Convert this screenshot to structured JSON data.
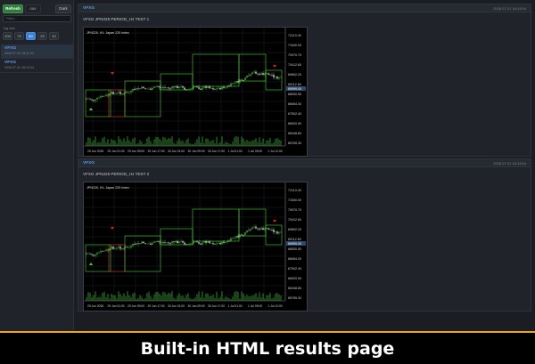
{
  "toolbar": {
    "refresh_label": "Refresh",
    "switch_label": "oav",
    "dark_label": "Dark"
  },
  "filter": {
    "placeholder": "Filter..."
  },
  "log_lines": {
    "label": "log size",
    "options": [
      "100",
      "75",
      "50",
      "25",
      "10"
    ],
    "active_index": 2
  },
  "sidebar_items": [
    {
      "title": "VFXG",
      "date": "2026.07.01 18:11:04"
    },
    {
      "title": "VFXG",
      "date": "2026.07.01 18:13:04"
    }
  ],
  "panels": [
    {
      "name": "VFXG",
      "date": "2026.07.01 18:13:04",
      "title": "VFXG JPN225 PERIOD_H1 TEST 1",
      "chart_label": "JPN225, H1:  Japan 225 Index",
      "price_labels": [
        "72113.40",
        "71540.00",
        "70970.70",
        "70412.60",
        "69692.20",
        "69112.60",
        "68530.50",
        "68084.00",
        "67502.40",
        "66920.90",
        "66348.80",
        "65765.30"
      ],
      "current_price": "69999.00",
      "time_labels": [
        "25 Jun 2026",
        "29 Jun 01:00",
        "29 Jun 09:00",
        "29 Jun 17:00",
        "30 Jun 01:00",
        "30 Jun 09:00",
        "30 Jun 17:00",
        "1 Jul 01:00",
        "1 Jul 09:00",
        "1 Jul 12:00"
      ]
    },
    {
      "name": "VFXG",
      "date": "2026.07.01 18:13:04",
      "title": "VFXG JPN225 PERIOD_H1 TEST 2",
      "chart_label": "JPN225, H1:  Japan 225 Index",
      "price_labels": [
        "72113.40",
        "71540.00",
        "70970.70",
        "70412.60",
        "69692.20",
        "69112.60",
        "68530.50",
        "68084.00",
        "67502.40",
        "66920.90",
        "66348.80",
        "65765.30"
      ],
      "current_price": "69999.00",
      "time_labels": [
        "25 Jun 2026",
        "29 Jun 01:00",
        "29 Jun 09:00",
        "29 Jun 17:00",
        "30 Jun 01:00",
        "30 Jun 09:00",
        "30 Jun 17:00",
        "1 Jul 01:00",
        "1 Jul 09:00",
        "1 Jul 12:00"
      ]
    }
  ],
  "caption": "Built-in HTML results page",
  "colors": {
    "accent_blue": "#5b9be8",
    "refresh_green": "#2e7d3a",
    "footer_gold": "#e8a32c",
    "bull": "#4cd137",
    "sell_arrow": "#e02020"
  }
}
